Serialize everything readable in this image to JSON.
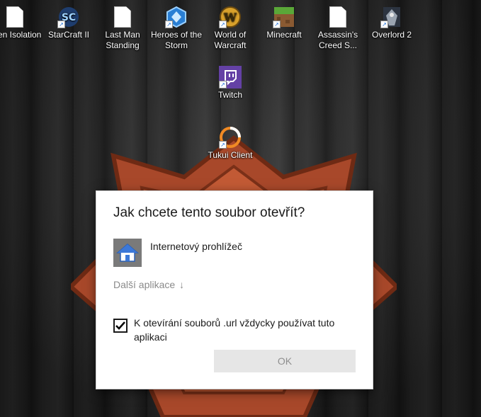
{
  "desktop": {
    "icons": [
      {
        "label": "Alien Isolation",
        "icon": "document-icon"
      },
      {
        "label": "StarCraft II",
        "icon": "starcraft-icon"
      },
      {
        "label": "Last Man Standing",
        "icon": "document-icon"
      },
      {
        "label": "Heroes of the Storm",
        "icon": "heroes-icon"
      },
      {
        "label": "World of Warcraft",
        "icon": "wow-icon"
      },
      {
        "label": "Minecraft",
        "icon": "minecraft-icon"
      },
      {
        "label": "Assassin's Creed S...",
        "icon": "document-icon"
      },
      {
        "label": "Overlord 2",
        "icon": "overlord-icon"
      },
      {
        "label": "Twitch",
        "icon": "twitch-icon"
      },
      {
        "label": "Tukui Client",
        "icon": "tukui-icon"
      }
    ]
  },
  "dialog": {
    "title": "Jak chcete tento soubor otevřít?",
    "app_label": "Internetový prohlížeč",
    "more_apps": "Další aplikace",
    "more_apps_arrow": "↓",
    "checkbox_label": "K otevírání souborů .url vždycky používat tuto aplikaci",
    "checkbox_checked": true,
    "ok_label": "OK"
  },
  "colors": {
    "crest": "#a8482a",
    "twitch": "#6441a5",
    "button_bg": "#e6e6e6"
  }
}
